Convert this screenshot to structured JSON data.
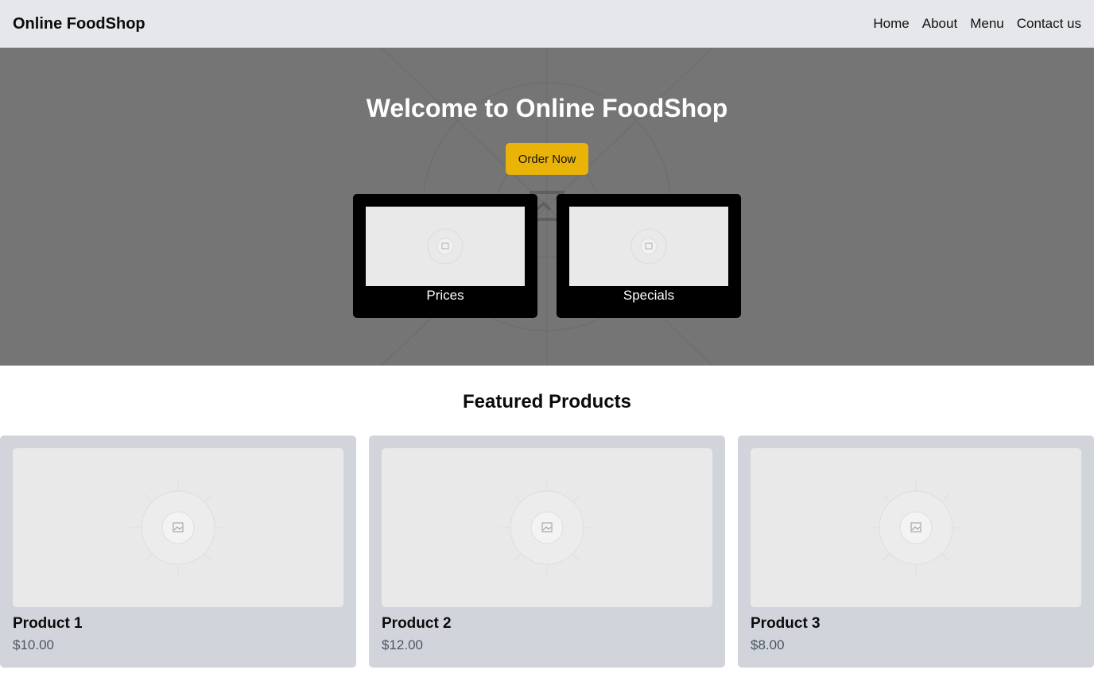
{
  "header": {
    "brand": "Online FoodShop",
    "nav": [
      "Home",
      "About",
      "Menu",
      "Contact us"
    ]
  },
  "hero": {
    "title": "Welcome to Online FoodShop",
    "cta_label": "Order Now",
    "cards": [
      {
        "label": "Prices",
        "icon": "image-placeholder-icon"
      },
      {
        "label": "Specials",
        "icon": "image-placeholder-icon"
      }
    ]
  },
  "featured": {
    "title": "Featured Products",
    "products": [
      {
        "name": "Product 1",
        "price": "$10.00",
        "icon": "image-placeholder-icon"
      },
      {
        "name": "Product 2",
        "price": "$12.00",
        "icon": "image-placeholder-icon"
      },
      {
        "name": "Product 3",
        "price": "$8.00",
        "icon": "image-placeholder-icon"
      }
    ]
  },
  "colors": {
    "header_bg": "#e5e7eb",
    "hero_overlay": "#757575",
    "cta": "#eab308",
    "card_bg": "#d1d5db",
    "price_text": "#4b5563"
  }
}
